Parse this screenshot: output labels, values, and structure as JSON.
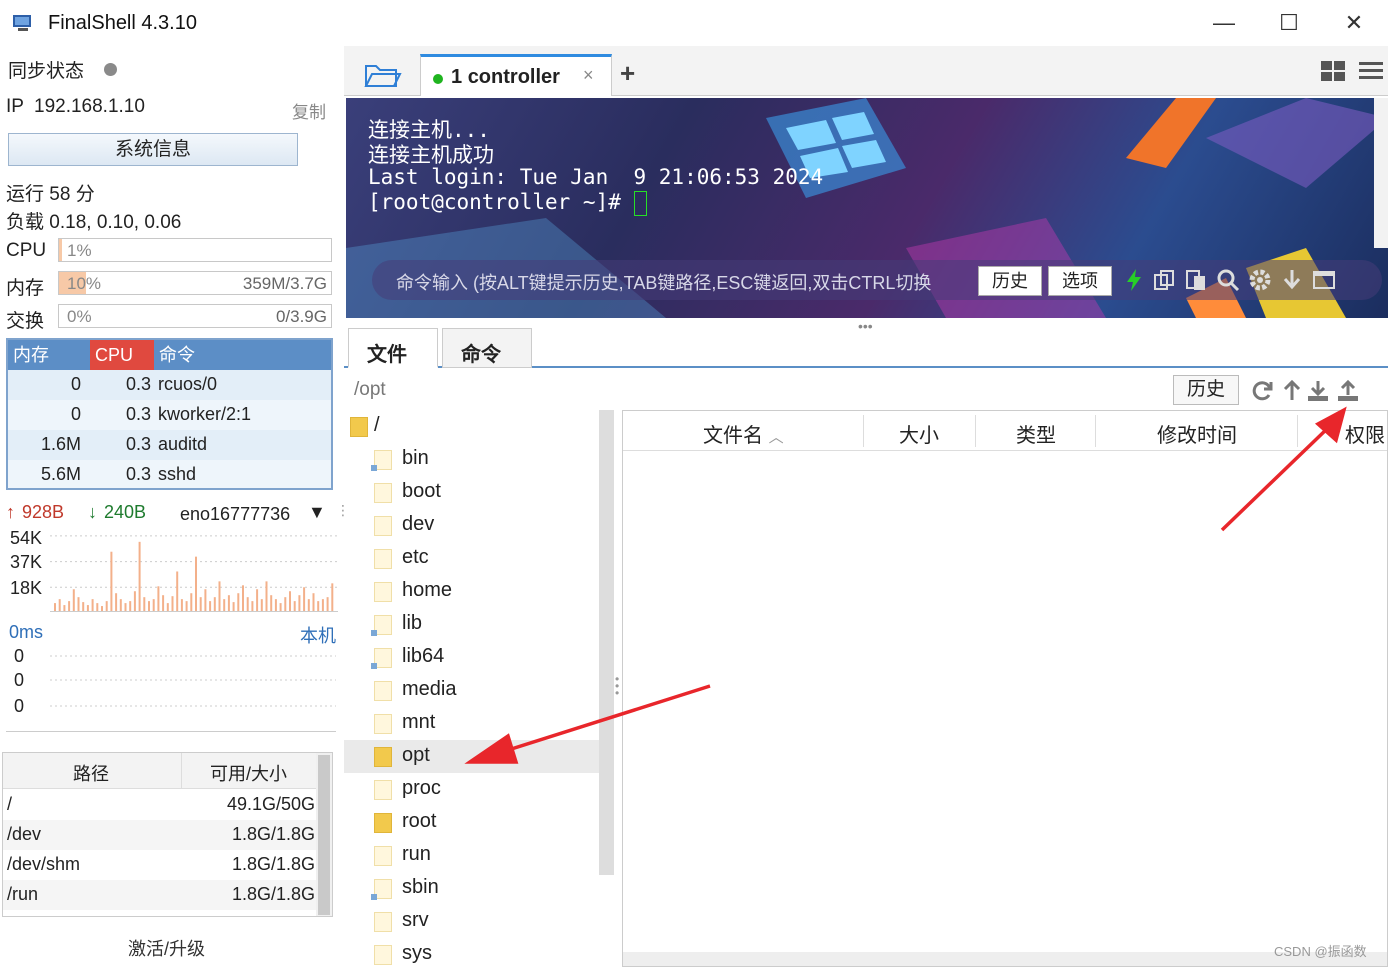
{
  "window": {
    "title": "FinalShell 4.3.10",
    "minimize": "—",
    "maximize": "☐",
    "close": "✕"
  },
  "left": {
    "sync_label": "同步状态",
    "ip_label": "IP",
    "ip": "192.168.1.10",
    "copy": "复制",
    "sysinfo_button": "系统信息",
    "uptime": "运行 58 分",
    "load": "负载 0.18, 0.10, 0.06",
    "cpu": {
      "label": "CPU",
      "percent": "1%",
      "fill": 0.01
    },
    "mem": {
      "label": "内存",
      "percent": "10%",
      "amount": "359M/3.7G",
      "fill": 0.1
    },
    "swap": {
      "label": "交换",
      "percent": "0%",
      "amount": "0/3.9G",
      "fill": 0
    },
    "proc_headers": [
      "内存",
      "CPU",
      "命令"
    ],
    "processes": [
      {
        "mem": "0",
        "cpu": "0.3",
        "cmd": "rcuos/0"
      },
      {
        "mem": "0",
        "cpu": "0.3",
        "cmd": "kworker/2:1"
      },
      {
        "mem": "1.6M",
        "cpu": "0.3",
        "cmd": "auditd"
      },
      {
        "mem": "5.6M",
        "cpu": "0.3",
        "cmd": "sshd"
      }
    ],
    "net": {
      "up": "928B",
      "down": "240B",
      "interface": "eno16777736",
      "ticks": [
        "54K",
        "37K",
        "18K"
      ]
    },
    "ping": {
      "latency": "0ms",
      "target": "本机",
      "values": [
        "0",
        "0",
        "0"
      ]
    },
    "disk_headers": [
      "路径",
      "可用/大小"
    ],
    "disks": [
      {
        "path": "/",
        "size": "49.1G/50G"
      },
      {
        "path": "/dev",
        "size": "1.8G/1.8G"
      },
      {
        "path": "/dev/shm",
        "size": "1.8G/1.8G"
      },
      {
        "path": "/run",
        "size": "1.8G/1.8G"
      }
    ],
    "upgrade": "激活/升级"
  },
  "tabs": {
    "session_number": "1",
    "session_name": "controller",
    "close": "×",
    "add": "+"
  },
  "terminal": {
    "lines": [
      "连接主机...",
      "连接主机成功",
      "Last login: Tue Jan  9 21:06:53 2024",
      "[root@controller ~]# "
    ],
    "cmd_placeholder": "命令输入 (按ALT键提示历史,TAB键路径,ESC键返回,双击CTRL切换",
    "history_button": "历史",
    "options_button": "选项"
  },
  "files": {
    "tab_file": "文件",
    "tab_cmd": "命令",
    "path": "/opt",
    "history_button": "历史",
    "tree": [
      {
        "name": "/",
        "style": "dark"
      },
      {
        "name": "bin",
        "style": "link"
      },
      {
        "name": "boot",
        "style": "plain"
      },
      {
        "name": "dev",
        "style": "plain"
      },
      {
        "name": "etc",
        "style": "plain"
      },
      {
        "name": "home",
        "style": "plain"
      },
      {
        "name": "lib",
        "style": "link"
      },
      {
        "name": "lib64",
        "style": "link"
      },
      {
        "name": "media",
        "style": "plain"
      },
      {
        "name": "mnt",
        "style": "plain"
      },
      {
        "name": "opt",
        "style": "dark",
        "selected": true
      },
      {
        "name": "proc",
        "style": "plain"
      },
      {
        "name": "root",
        "style": "dark"
      },
      {
        "name": "run",
        "style": "plain"
      },
      {
        "name": "sbin",
        "style": "link"
      },
      {
        "name": "srv",
        "style": "plain"
      },
      {
        "name": "sys",
        "style": "plain"
      }
    ],
    "columns": [
      "文件名",
      "大小",
      "类型",
      "修改时间",
      "权限"
    ]
  },
  "watermark": "CSDN @振函数",
  "colors": {
    "accent": "#2f8be0",
    "arrow": "#e8262b",
    "meter_fill": "#f7c9a7",
    "proc_header": "#5c8ec6"
  }
}
